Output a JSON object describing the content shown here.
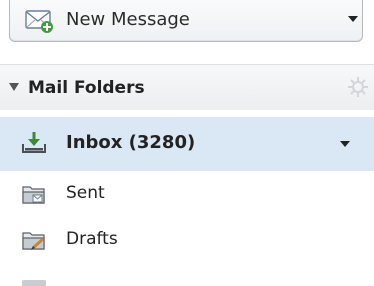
{
  "new_message": {
    "label": "New Message",
    "icon": "new-message-envelope-icon"
  },
  "mail_folders": {
    "header_label": "Mail Folders",
    "settings_icon": "gear-icon",
    "folders": [
      {
        "name": "Inbox",
        "count_text": "(3280)",
        "label": "Inbox (3280)",
        "icon": "inbox-download-icon",
        "selected": true
      },
      {
        "name": "Sent",
        "label": "Sent",
        "icon": "sent-folder-icon",
        "selected": false
      },
      {
        "name": "Drafts",
        "label": "Drafts",
        "icon": "drafts-folder-icon",
        "selected": false
      }
    ]
  },
  "colors": {
    "selected_row": "#dae8f6",
    "button_border": "#b5b9be",
    "header_bg": "#eceef1"
  }
}
